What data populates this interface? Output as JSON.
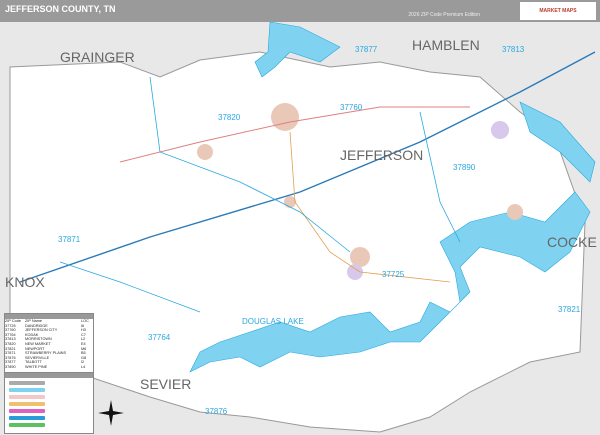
{
  "header": {
    "title": "JEFFERSON COUNTY, TN",
    "edition": "2026 ZIP Code Premium Edition",
    "logo": "MARKET MAPS"
  },
  "map_labels": {
    "counties": [
      "GRAINGER",
      "HAMBLEN",
      "JEFFERSON",
      "KNOX",
      "COCKE",
      "SEVIER"
    ],
    "lake": "DOUGLAS LAKE",
    "zips": [
      "37877",
      "37813",
      "37760",
      "37820",
      "37890",
      "37871",
      "37725",
      "37764",
      "37821",
      "37876"
    ]
  },
  "zip_table": {
    "headers": [
      "ZIP Code",
      "ZIP Name",
      "LOC"
    ],
    "rows": [
      [
        "37725",
        "DANDRIDGE",
        "I6"
      ],
      [
        "37760",
        "JEFFERSON CITY",
        "H3"
      ],
      [
        "37764",
        "KODAK",
        "C7"
      ],
      [
        "37813",
        "MORRISTOWN",
        "L2"
      ],
      [
        "37820",
        "NEW MARKET",
        "E4"
      ],
      [
        "37821",
        "NEWPORT",
        "M6"
      ],
      [
        "37871",
        "STRAWBERRY PLAINS",
        "B5"
      ],
      [
        "37876",
        "SEVIERVILLE",
        "G8"
      ],
      [
        "37877",
        "TALBOTT",
        "I2"
      ],
      [
        "37890",
        "WHITE PINE",
        "L4"
      ]
    ]
  },
  "colors": {
    "water": "#7fd3f0",
    "county_fill": "#ffffff",
    "outside": "#e8e8e8",
    "zip_line": "#29a8e0",
    "interstate": "#2a7ab8"
  }
}
